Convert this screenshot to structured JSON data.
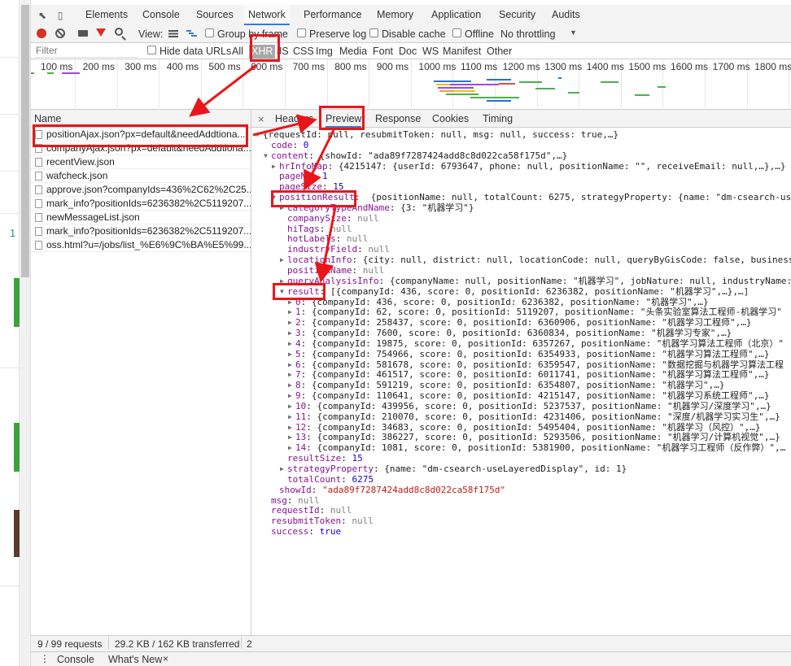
{
  "devtools_tabs": [
    "Elements",
    "Console",
    "Sources",
    "Network",
    "Performance",
    "Memory",
    "Application",
    "Security",
    "Audits"
  ],
  "active_tab": "Network",
  "toolbar": {
    "view_label": "View:",
    "group_by_frame": "Group by frame",
    "preserve_log": "Preserve log",
    "disable_cache": "Disable cache",
    "offline": "Offline",
    "throttling": "No throttling"
  },
  "filter": {
    "placeholder": "Filter",
    "hide_data_urls": "Hide data URLs",
    "types": [
      "All",
      "XHR",
      "JS",
      "CSS",
      "Img",
      "Media",
      "Font",
      "Doc",
      "WS",
      "Manifest",
      "Other"
    ],
    "active_type": "XHR"
  },
  "timeline_ticks": [
    "100 ms",
    "200 ms",
    "300 ms",
    "400 ms",
    "500 ms",
    "600 ms",
    "700 ms",
    "800 ms",
    "900 ms",
    "1000 ms",
    "1100 ms",
    "1200 ms",
    "1300 ms",
    "1400 ms",
    "1500 ms",
    "1600 ms",
    "1700 ms",
    "1800 ms"
  ],
  "requests_header": "Name",
  "requests": [
    "positionAjax.json?px=default&needAddtiona...",
    "companyAjax.json?px=default&needAddtiona...",
    "recentView.json",
    "wafcheck.json",
    "approve.json?companyIds=436%2C62%2C25...",
    "mark_info?positionIds=6236382%2C5119207...",
    "newMessageList.json",
    "mark_info?positionIds=6236382%2C5119207...",
    "oss.html?u=/jobs/list_%E6%9C%BA%E5%99..."
  ],
  "detail_tabs": [
    "Headers",
    "Preview",
    "Response",
    "Cookies",
    "Timing"
  ],
  "active_detail_tab": "Preview",
  "json_lines": {
    "root": "{requestId: null, resubmitToken: null, msg: null, success: true,…}",
    "code_key": "code",
    "code_val": "0",
    "content_key": "content",
    "content_summary": "{showId: \"ada89f7287424add8c8d022ca58f175d\",…}",
    "hrInfoMap_key": "hrInfoMap",
    "hrInfoMap_val": "{4215147: {userId: 6793647, phone: null, positionName: \"\", receiveEmail: null,…},…}",
    "pageNo_key": "pageNo",
    "pageNo_val": "1",
    "pageSize_key": "pageSize",
    "pageSize_val": "15",
    "positionResult_key": "positionResult",
    "positionResult_val": "{positionName: null, totalCount: 6275, strategyProperty: {name: \"dm-csearch-useL",
    "categoryTypeAndName_key": "categoryTypeAndName",
    "categoryTypeAndName_val": "{3: \"机器学习\"}",
    "companySize_key": "companySize",
    "hiTags_key": "hiTags",
    "hotLabels_key": "hotLabels",
    "industryField_key": "industryField",
    "locationInfo_key": "locationInfo",
    "locationInfo_val": "{city: null, district: null, locationCode: null, queryByGisCode: false, business",
    "positionName_key": "positionName",
    "queryAnalysisInfo_key": "queryAnalysisInfo",
    "queryAnalysisInfo_val": "{companyName: null, positionName: \"机器学习\", jobNature: null, industryName:",
    "result_key": "result",
    "result_val": "[{companyId: 436, score: 0, positionId: 6236382, positionName: \"机器学习\",…},…]",
    "null_val": "null",
    "results": [
      {
        "idx": "0",
        "text": "{companyId: 436, score: 0, positionId: 6236382, positionName: \"机器学习\",…}"
      },
      {
        "idx": "1",
        "text": "{companyId: 62, score: 0, positionId: 5119207, positionName: \"头条实验室算法工程师-机器学习\""
      },
      {
        "idx": "2",
        "text": "{companyId: 258437, score: 0, positionId: 6360906, positionName: \"机器学习工程师\",…}"
      },
      {
        "idx": "3",
        "text": "{companyId: 7600, score: 0, positionId: 6360834, positionName: \"机器学习专家\",…}"
      },
      {
        "idx": "4",
        "text": "{companyId: 19875, score: 0, positionId: 6357267, positionName: \"机器学习算法工程师（北京）\""
      },
      {
        "idx": "5",
        "text": "{companyId: 754966, score: 0, positionId: 6354933, positionName: \"机器学习算法工程师\",…}"
      },
      {
        "idx": "6",
        "text": "{companyId: 581678, score: 0, positionId: 6359547, positionName: \"数据挖掘与机器学习算法工程"
      },
      {
        "idx": "7",
        "text": "{companyId: 461517, score: 0, positionId: 6011741, positionName: \"机器学习算法工程师\",…}"
      },
      {
        "idx": "8",
        "text": "{companyId: 591219, score: 0, positionId: 6354807, positionName: \"机器学习\",…}"
      },
      {
        "idx": "9",
        "text": "{companyId: 110641, score: 0, positionId: 4215147, positionName: \"机器学习系统工程师\",…}"
      },
      {
        "idx": "10",
        "text": "{companyId: 439956, score: 0, positionId: 5237537, positionName: \"机器学习/深度学习\",…}"
      },
      {
        "idx": "11",
        "text": "{companyId: 210070, score: 0, positionId: 4231406, positionName: \"深度/机器学习实习生\",…}"
      },
      {
        "idx": "12",
        "text": "{companyId: 34683, score: 0, positionId: 5495404, positionName: \"机器学习（风控）\",…}"
      },
      {
        "idx": "13",
        "text": "{companyId: 386227, score: 0, positionId: 5293506, positionName: \"机器学习/计算机视觉\",…}"
      },
      {
        "idx": "14",
        "text": "{companyId: 1081, score: 0, positionId: 5381900, positionName: \"机器学习工程师（反作弊）\",…"
      }
    ],
    "resultSize_key": "resultSize",
    "resultSize_val": "15",
    "strategyProperty_key": "strategyProperty",
    "strategyProperty_val": "{name: \"dm-csearch-useLayeredDisplay\", id: 1}",
    "totalCount_key": "totalCount",
    "totalCount_val": "6275",
    "showId_key": "showId",
    "showId_val": "\"ada89f7287424add8c8d022ca58f175d\"",
    "msg_key": "msg",
    "requestId_key": "requestId",
    "resubmitToken_key": "resubmitToken",
    "success_key": "success",
    "success_val": "true"
  },
  "status": {
    "requests": "9 / 99 requests",
    "transferred": "29.2 KB / 162 KB transferred",
    "extra": "2"
  },
  "drawer": {
    "console": "Console",
    "whats_new": "What's New"
  },
  "colors": {
    "accent_blue": "#3879d9",
    "annotation_red": "#e8161a",
    "json_key": "#881391",
    "json_string": "#c41a16",
    "json_number": "#1c00cf"
  }
}
